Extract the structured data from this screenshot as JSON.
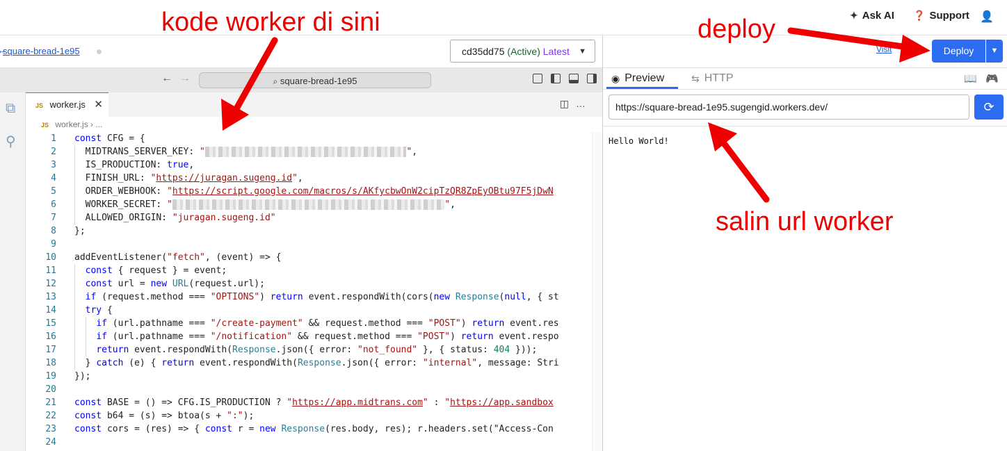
{
  "topbar": {
    "ask_ai": "Ask AI",
    "support": "Support"
  },
  "left_header": {
    "worker_name": "square-bread-1e95",
    "version": {
      "id": "cd35dd75",
      "status": "(Active)",
      "tag": "Latest"
    }
  },
  "editor": {
    "command_center": "square-bread-1e95",
    "tab_label": "worker.js",
    "tab_badge": "JS",
    "breadcrumb": "worker.js",
    "breadcrumb_rest": "› ...",
    "lines": [
      "const CFG = {",
      "  MIDTRANS_SERVER_KEY: \"█████████████████████████████████████\",",
      "  IS_PRODUCTION: true,",
      "  FINISH_URL: \"https://juragan.sugeng.id\",",
      "  ORDER_WEBHOOK: \"https://script.google.com/macros/s/AKfycbwOnW2cipTzQR8ZpEyOBtu97F5jDwN",
      "  WORKER_SECRET: \"██████████████████████████████████████████████████\",",
      "  ALLOWED_ORIGIN: \"juragan.sugeng.id\"",
      "};",
      "",
      "addEventListener(\"fetch\", (event) => {",
      "  const { request } = event;",
      "  const url = new URL(request.url);",
      "  if (request.method === \"OPTIONS\") return event.respondWith(cors(new Response(null, { st",
      "  try {",
      "    if (url.pathname === \"/create-payment\" && request.method === \"POST\") return event.res",
      "    if (url.pathname === \"/notification\" && request.method === \"POST\") return event.respo",
      "    return event.respondWith(Response.json({ error: \"not_found\" }, { status: 404 }));",
      "  } catch (e) { return event.respondWith(Response.json({ error: \"internal\", message: Stri",
      "});",
      "",
      "const BASE = () => CFG.IS_PRODUCTION ? \"https://app.midtrans.com\" : \"https://app.sandbox",
      "const b64 = (s) => btoa(s + \":\");",
      "const cors = (res) => { const r = new Response(res.body, res); r.headers.set(\"Access-Con",
      ""
    ]
  },
  "right_panel": {
    "visit_label": "Visit",
    "deploy_label": "Deploy",
    "tab_preview": "Preview",
    "tab_http": "HTTP",
    "url": "https://square-bread-1e95.sugengid.workers.dev/",
    "output": "Hello World!"
  },
  "annotations": {
    "code_note": "kode worker di sini",
    "deploy_note": "deploy",
    "url_note": "salin url worker"
  },
  "colors": {
    "accent": "#2b6cf0",
    "annotation": "#ee0000",
    "latest_tag": "#7c3aed"
  }
}
